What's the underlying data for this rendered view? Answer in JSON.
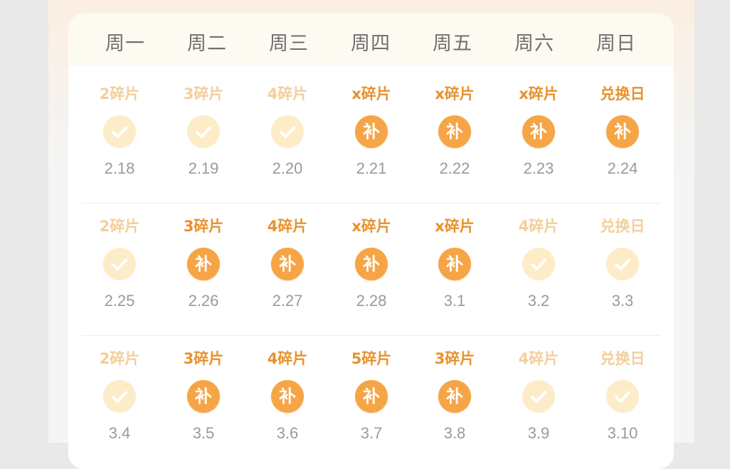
{
  "weekdays": [
    "周一",
    "周二",
    "周三",
    "周四",
    "周五",
    "周六",
    "周日"
  ],
  "makeup_text": "补",
  "colors": {
    "completed_label": "#f2cf9c",
    "pending_label": "#e8922e",
    "completed_badge": "#fdecc8",
    "pending_badge": "#f6a546",
    "date": "#9a9a9a"
  },
  "weeks": [
    {
      "days": [
        {
          "label": "2碎片",
          "date": "2.18",
          "status": "completed"
        },
        {
          "label": "3碎片",
          "date": "2.19",
          "status": "completed"
        },
        {
          "label": "4碎片",
          "date": "2.20",
          "status": "completed"
        },
        {
          "label": "x碎片",
          "date": "2.21",
          "status": "makeup"
        },
        {
          "label": "x碎片",
          "date": "2.22",
          "status": "makeup"
        },
        {
          "label": "x碎片",
          "date": "2.23",
          "status": "makeup"
        },
        {
          "label": "兑换日",
          "date": "2.24",
          "status": "makeup"
        }
      ]
    },
    {
      "days": [
        {
          "label": "2碎片",
          "date": "2.25",
          "status": "completed"
        },
        {
          "label": "3碎片",
          "date": "2.26",
          "status": "makeup"
        },
        {
          "label": "4碎片",
          "date": "2.27",
          "status": "makeup"
        },
        {
          "label": "x碎片",
          "date": "2.28",
          "status": "makeup"
        },
        {
          "label": "x碎片",
          "date": "3.1",
          "status": "makeup"
        },
        {
          "label": "4碎片",
          "date": "3.2",
          "status": "completed"
        },
        {
          "label": "兑换日",
          "date": "3.3",
          "status": "completed"
        }
      ]
    },
    {
      "days": [
        {
          "label": "2碎片",
          "date": "3.4",
          "status": "completed"
        },
        {
          "label": "3碎片",
          "date": "3.5",
          "status": "makeup"
        },
        {
          "label": "4碎片",
          "date": "3.6",
          "status": "makeup"
        },
        {
          "label": "5碎片",
          "date": "3.7",
          "status": "makeup"
        },
        {
          "label": "3碎片",
          "date": "3.8",
          "status": "makeup"
        },
        {
          "label": "4碎片",
          "date": "3.9",
          "status": "completed"
        },
        {
          "label": "兑换日",
          "date": "3.10",
          "status": "completed"
        }
      ]
    }
  ]
}
